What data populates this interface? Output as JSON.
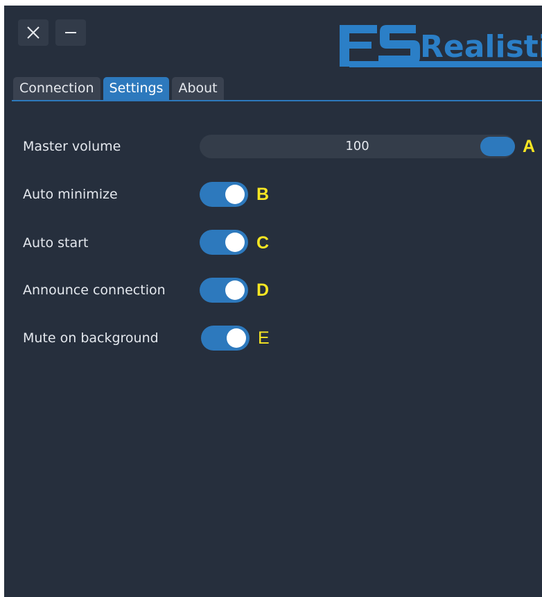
{
  "window": {
    "controls": {
      "close_icon": "close-icon",
      "minimize_icon": "minimize-icon"
    }
  },
  "logo": {
    "text": "Realistic",
    "color": "#2b7fc7"
  },
  "tabs": [
    {
      "label": "Connection",
      "active": false
    },
    {
      "label": "Settings",
      "active": true
    },
    {
      "label": "About",
      "active": false
    }
  ],
  "settings": {
    "master_volume": {
      "label": "Master volume",
      "value": "100",
      "level_percent": 100
    },
    "auto_minimize": {
      "label": "Auto minimize",
      "on": true
    },
    "auto_start": {
      "label": "Auto start",
      "on": true
    },
    "announce_connection": {
      "label": "Announce connection",
      "on": true
    },
    "mute_on_background": {
      "label": "Mute on background",
      "on": true
    }
  },
  "annotations": {
    "a": "A",
    "b": "B",
    "c": "C",
    "d": "D",
    "e": "E"
  },
  "colors": {
    "background": "#262f3d",
    "accent": "#2d79bd",
    "annotation": "#f7e623"
  }
}
